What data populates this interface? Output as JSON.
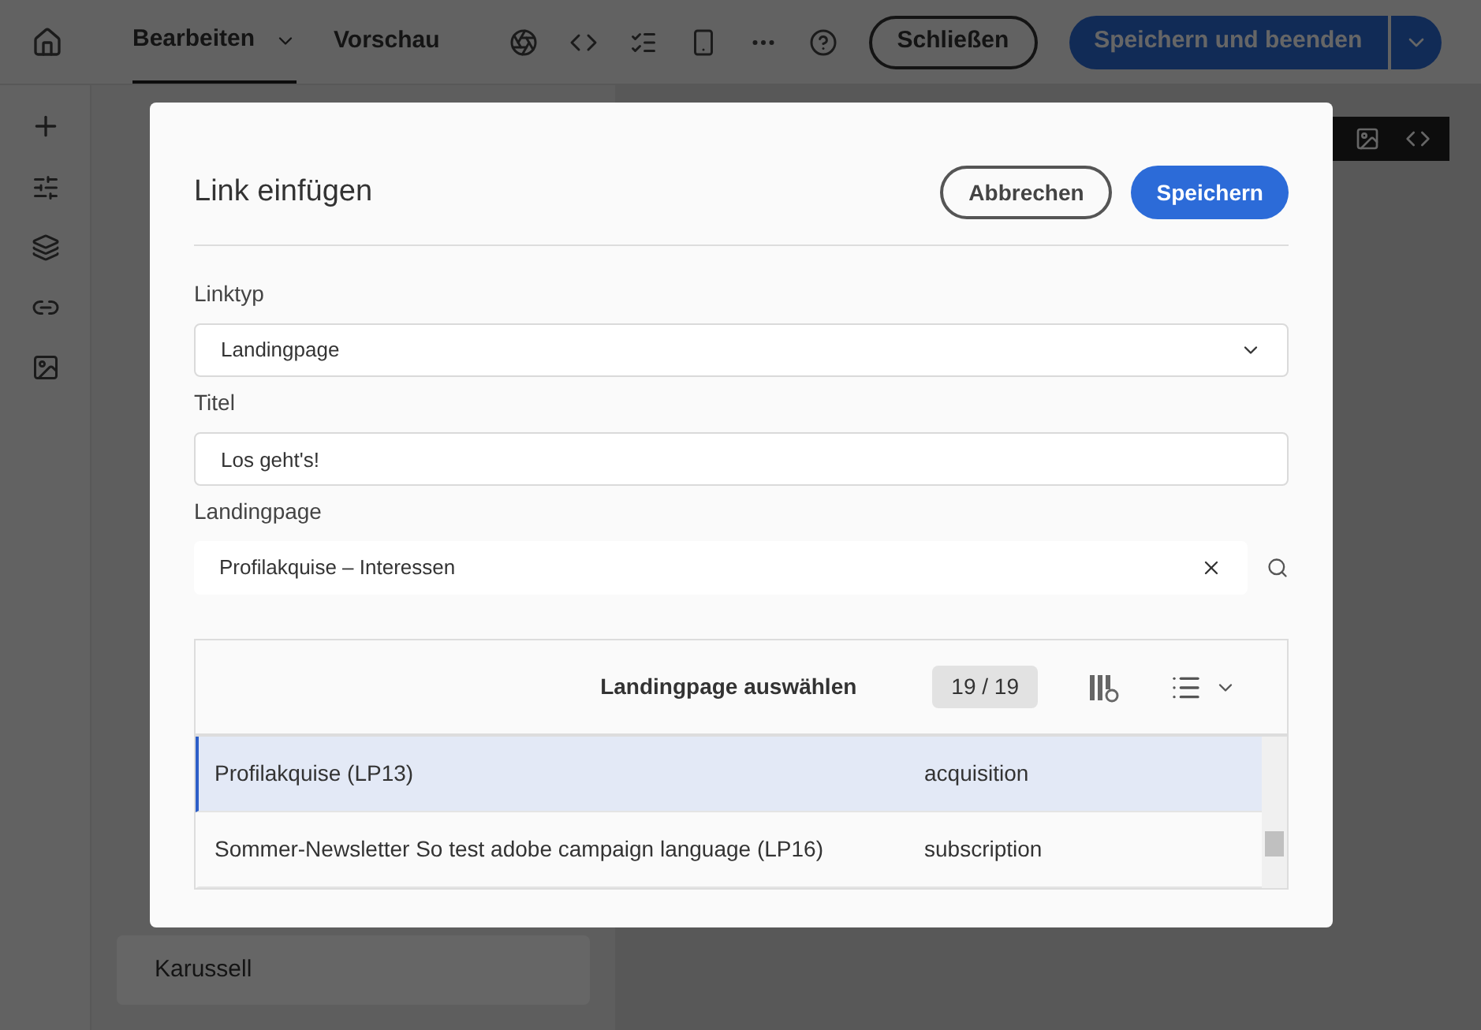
{
  "topbar": {
    "tabs": [
      {
        "label": "Bearbeiten",
        "selected": true
      },
      {
        "label": "Vorschau",
        "selected": false
      }
    ],
    "close_button": "Schließen",
    "save_button": "Speichern und beenden"
  },
  "left_panel": {
    "items": [
      {
        "label": "Karussell"
      }
    ]
  },
  "dialog": {
    "title": "Link einfügen",
    "cancel_button": "Abbrechen",
    "save_button": "Speichern",
    "fields": [
      {
        "kind": "select",
        "label": "Linktyp",
        "value": "Landingpage"
      },
      {
        "kind": "text",
        "label": "Titel",
        "value": "Los geht's!"
      },
      {
        "kind": "lookup",
        "label": "Landingpage",
        "value": "Profilakquise – Interessen"
      }
    ],
    "table": {
      "title": "Landingpage auswählen",
      "count": "19 / 19",
      "rows": [
        {
          "name": "Profilakquise (LP13)",
          "type": "acquisition",
          "selected": true
        },
        {
          "name": "Sommer-Newsletter So test adobe campaign language (LP16)",
          "type": "subscription",
          "selected": false
        }
      ]
    }
  }
}
